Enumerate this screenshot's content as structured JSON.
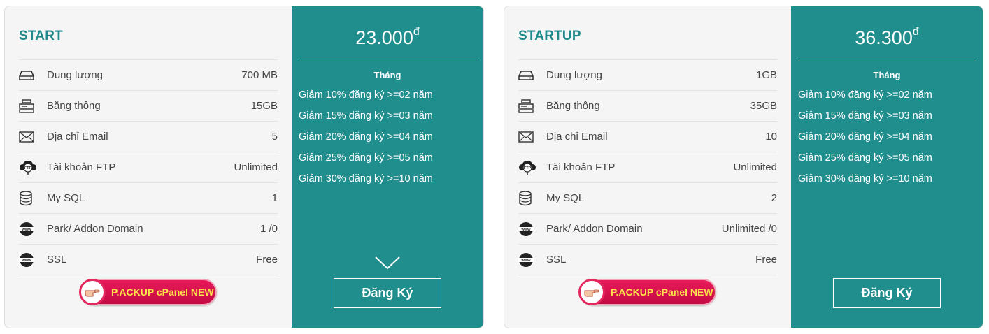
{
  "plans": [
    {
      "name": "START",
      "features": [
        {
          "icon": "hdd-icon",
          "label": "Dung lượng",
          "value": "700 MB"
        },
        {
          "icon": "bandwidth-icon",
          "label": "Băng thông",
          "value": "15GB"
        },
        {
          "icon": "email-icon",
          "label": "Địa chỉ Email",
          "value": "5"
        },
        {
          "icon": "ftp-cloud-icon",
          "label": "Tài khoản FTP",
          "value": "Unlimited"
        },
        {
          "icon": "database-icon",
          "label": "My SQL",
          "value": "1"
        },
        {
          "icon": "www-globe-icon",
          "label": "Park/ Addon Domain",
          "value": "1 /0"
        },
        {
          "icon": "www-globe-icon",
          "label": "SSL",
          "value": "Free"
        }
      ],
      "promo_label": "P.ACKUP cPanel NEW",
      "price": "23.000",
      "currency": "đ",
      "period": "Tháng",
      "discounts": [
        "Giảm 10% đăng ký >=02 năm",
        "Giảm 15% đăng ký >=03 năm",
        "Giảm 20% đăng ký >=04 năm",
        "Giảm 25% đăng ký >=05 năm",
        "Giảm 30% đăng ký >=10 năm"
      ],
      "register_label": "Đăng Ký"
    },
    {
      "name": "STARTUP",
      "features": [
        {
          "icon": "hdd-icon",
          "label": "Dung lượng",
          "value": "1GB"
        },
        {
          "icon": "bandwidth-icon",
          "label": "Băng thông",
          "value": "35GB"
        },
        {
          "icon": "email-icon",
          "label": "Địa chỉ Email",
          "value": "10"
        },
        {
          "icon": "ftp-cloud-icon",
          "label": "Tài khoản FTP",
          "value": "Unlimited"
        },
        {
          "icon": "database-icon",
          "label": "My SQL",
          "value": "2"
        },
        {
          "icon": "www-globe-icon",
          "label": "Park/ Addon Domain",
          "value": "Unlimited /0"
        },
        {
          "icon": "www-globe-icon",
          "label": "SSL",
          "value": "Free"
        }
      ],
      "promo_label": "P.ACKUP cPanel NEW",
      "price": "36.300",
      "currency": "đ",
      "period": "Tháng",
      "discounts": [
        "Giảm 10% đăng ký >=02 năm",
        "Giảm 15% đăng ký >=03 năm",
        "Giảm 20% đăng ký >=04 năm",
        "Giảm 25% đăng ký >=05 năm",
        "Giảm 30% đăng ký >=10 năm"
      ],
      "register_label": "Đăng Ký"
    }
  ],
  "colors": {
    "accent": "#218e8e",
    "plan_name": "#1f8a8a",
    "promo": "#d4104a",
    "promo_text": "#ffe34a"
  }
}
